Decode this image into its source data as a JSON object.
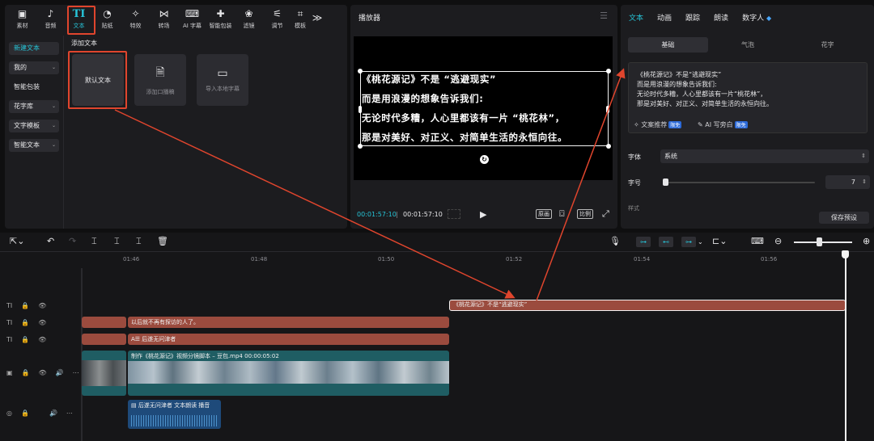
{
  "toolbar": {
    "items": [
      {
        "icon": "media-icon",
        "glyph": "▣",
        "label": "素材"
      },
      {
        "icon": "audio-icon",
        "glyph": "♪",
        "label": "音频"
      },
      {
        "icon": "text-icon",
        "glyph": "TI",
        "label": "文本"
      },
      {
        "icon": "sticker-icon",
        "glyph": "◔",
        "label": "贴纸"
      },
      {
        "icon": "effects-icon",
        "glyph": "✧",
        "label": "特效"
      },
      {
        "icon": "transition-icon",
        "glyph": "⋈",
        "label": "转场"
      },
      {
        "icon": "ai-caption-icon",
        "glyph": "⌨",
        "label": "AI 字幕"
      },
      {
        "icon": "smart-package-icon",
        "glyph": "✚",
        "label": "智能包装"
      },
      {
        "icon": "filter-icon",
        "glyph": "❀",
        "label": "滤镜"
      },
      {
        "icon": "adjust-icon",
        "glyph": "⚟",
        "label": "调节"
      },
      {
        "icon": "template-icon",
        "glyph": "⌗",
        "label": "模板"
      }
    ],
    "more": "≫"
  },
  "sidebar": {
    "items": [
      {
        "label": "新建文本",
        "state": "selected"
      },
      {
        "label": "我的",
        "dropdown": true
      },
      {
        "label": "智能包装"
      },
      {
        "label": "花字库",
        "dropdown": true
      },
      {
        "label": "文字模板",
        "dropdown": true
      },
      {
        "label": "智能文本",
        "dropdown": true
      }
    ]
  },
  "content": {
    "title": "添加文本",
    "cards": [
      {
        "label": "默认文本"
      },
      {
        "label": "添加口播稿"
      },
      {
        "label": "导入本地字幕"
      }
    ]
  },
  "player": {
    "title": "播放器",
    "subtitle_lines": [
      "《桃花源记》不是 “逃避现实”",
      "而是用浪漫的想象告诉我们:",
      "无论时代多糟，人心里都该有一片 “桃花林”，",
      "那是对美好、对正义、对简单生活的永恒向往。"
    ],
    "time_current": "00:01:57:10",
    "time_total": "00:01:57:10",
    "btn_original": "原画",
    "btn_ratio": "比例"
  },
  "props": {
    "tabs": [
      "文本",
      "动画",
      "跟踪",
      "朗读",
      "数字人"
    ],
    "subtabs": [
      "基础",
      "气泡",
      "花字"
    ],
    "text_lines": [
      "《桃花源记》不是“逃避现实”",
      "而是用浪漫的想象告诉我们:",
      "无论时代多糟，人心里都该有一片“桃花林”，",
      "那是对美好、对正义、对简单生活的永恒向往。"
    ],
    "tip_copy": "文案推荐",
    "tip_ai": "AI 写旁白",
    "badge": "限免",
    "font_label": "字体",
    "font_value": "系统",
    "size_label": "字号",
    "size_value": "7",
    "style_label": "样式",
    "save_label": "保存预设"
  },
  "timeline": {
    "ruler": [
      "01:46",
      "01:48",
      "01:50",
      "01:52",
      "01:54",
      "01:56"
    ],
    "clips": {
      "selected_text": "《桃花源记》不是“逃避现实”",
      "text_track1": "以后就不再有探访的人了。",
      "text_track2": "后遂无问津者",
      "video": "制作《桃花源记》视频分镜脚本 – 豆包.mp4   00:00:05:02",
      "audio": "后遂无问津者    文本朗读 播音"
    }
  }
}
